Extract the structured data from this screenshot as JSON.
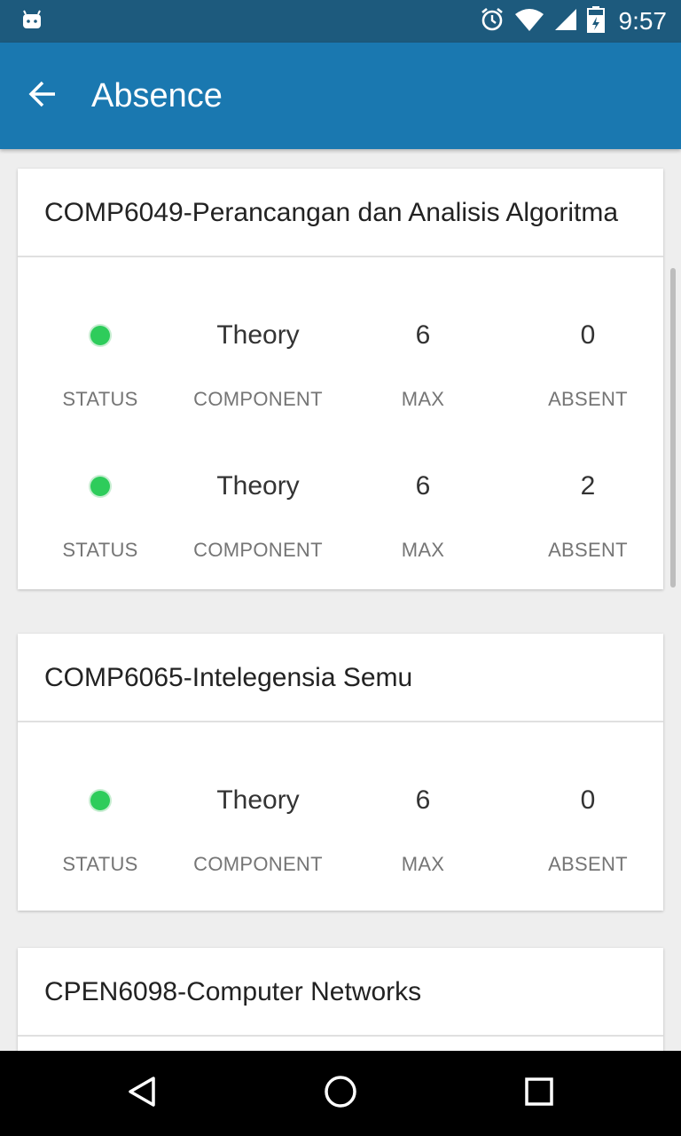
{
  "status_bar": {
    "time": "9:57",
    "icons": [
      "android-icon",
      "alarm-icon",
      "wifi-icon",
      "signal-icon",
      "battery-icon"
    ]
  },
  "app_bar": {
    "title": "Absence",
    "back_icon": "arrow-left-icon"
  },
  "labels": {
    "status": "STATUS",
    "component": "COMPONENT",
    "max": "MAX",
    "absent": "ABSENT"
  },
  "courses": [
    {
      "title": "COMP6049-Perancangan dan Analisis Algoritma",
      "rows": [
        {
          "status": "green",
          "component": "Theory",
          "max": "6",
          "absent": "0"
        },
        {
          "status": "green",
          "component": "Theory",
          "max": "6",
          "absent": "2"
        }
      ]
    },
    {
      "title": "COMP6065-Intelegensia Semu",
      "rows": [
        {
          "status": "green",
          "component": "Theory",
          "max": "6",
          "absent": "0"
        }
      ]
    },
    {
      "title": "CPEN6098-Computer Networks",
      "rows": []
    }
  ],
  "colors": {
    "status_bar": "#1d5a7d",
    "app_bar": "#1a78b0",
    "status_ok": "#2ecc5b",
    "background": "#eeeeee"
  },
  "nav_bar": {
    "icons": [
      "back-triangle-icon",
      "home-circle-icon",
      "recents-square-icon"
    ]
  }
}
